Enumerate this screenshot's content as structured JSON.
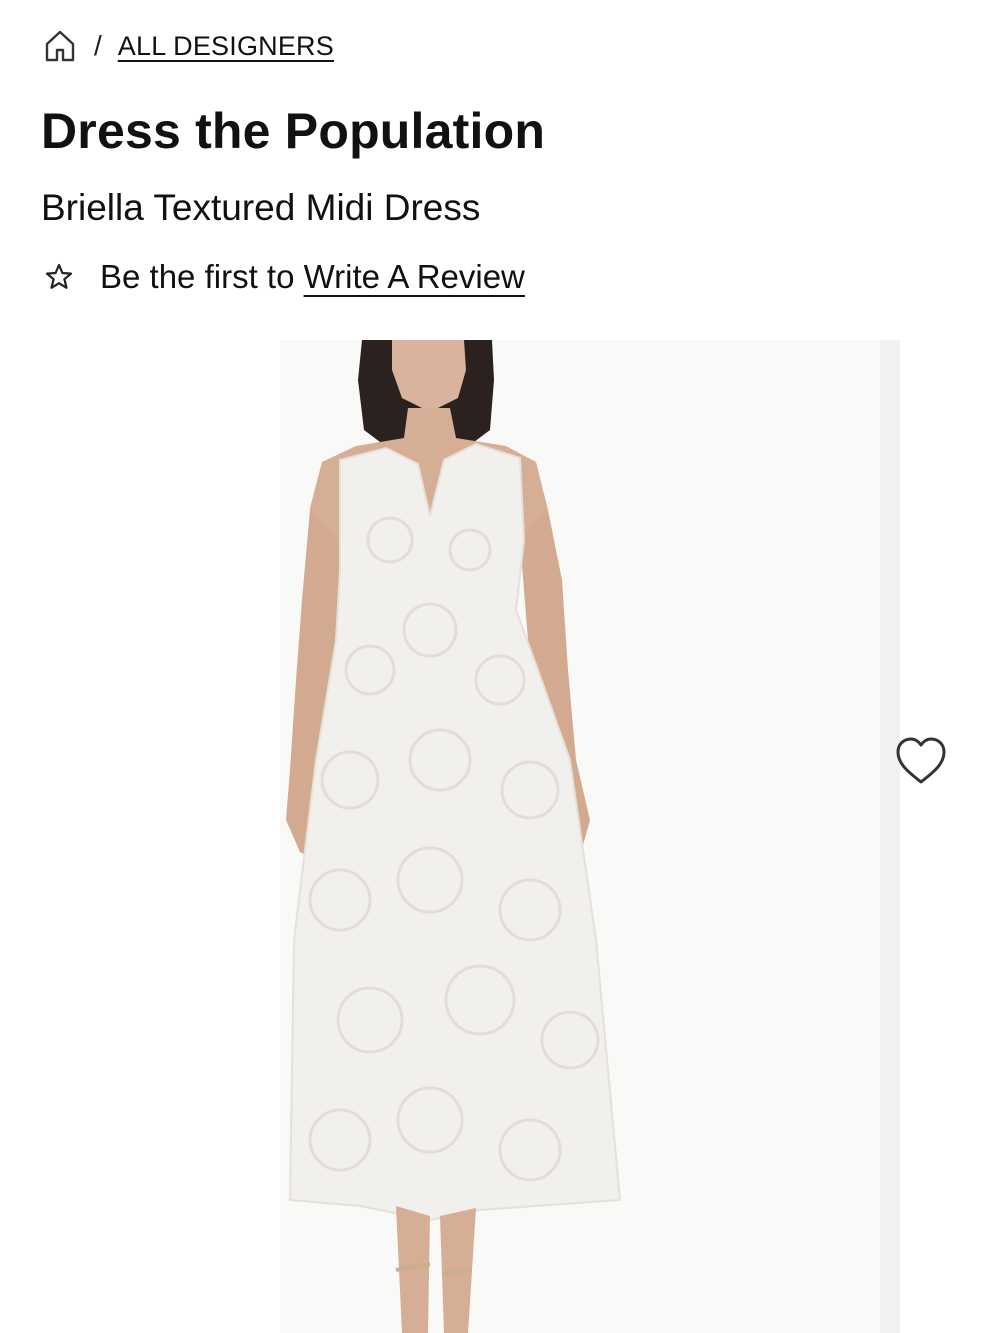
{
  "breadcrumb": {
    "home_icon": "home-icon",
    "separator": "/",
    "link_label": "ALL DESIGNERS"
  },
  "product": {
    "brand": "Dress the Population",
    "name": "Briella Textured Midi Dress"
  },
  "reviews": {
    "icon": "star-outline-icon",
    "prompt": "Be the first to ",
    "link_label": "Write A Review"
  },
  "gallery": {
    "image_description_icon": "product-photo",
    "wishlist_icon": "heart-outline-icon"
  },
  "colors": {
    "text": "#111111",
    "background": "#ffffff",
    "image_background": "#f9f9f7"
  }
}
